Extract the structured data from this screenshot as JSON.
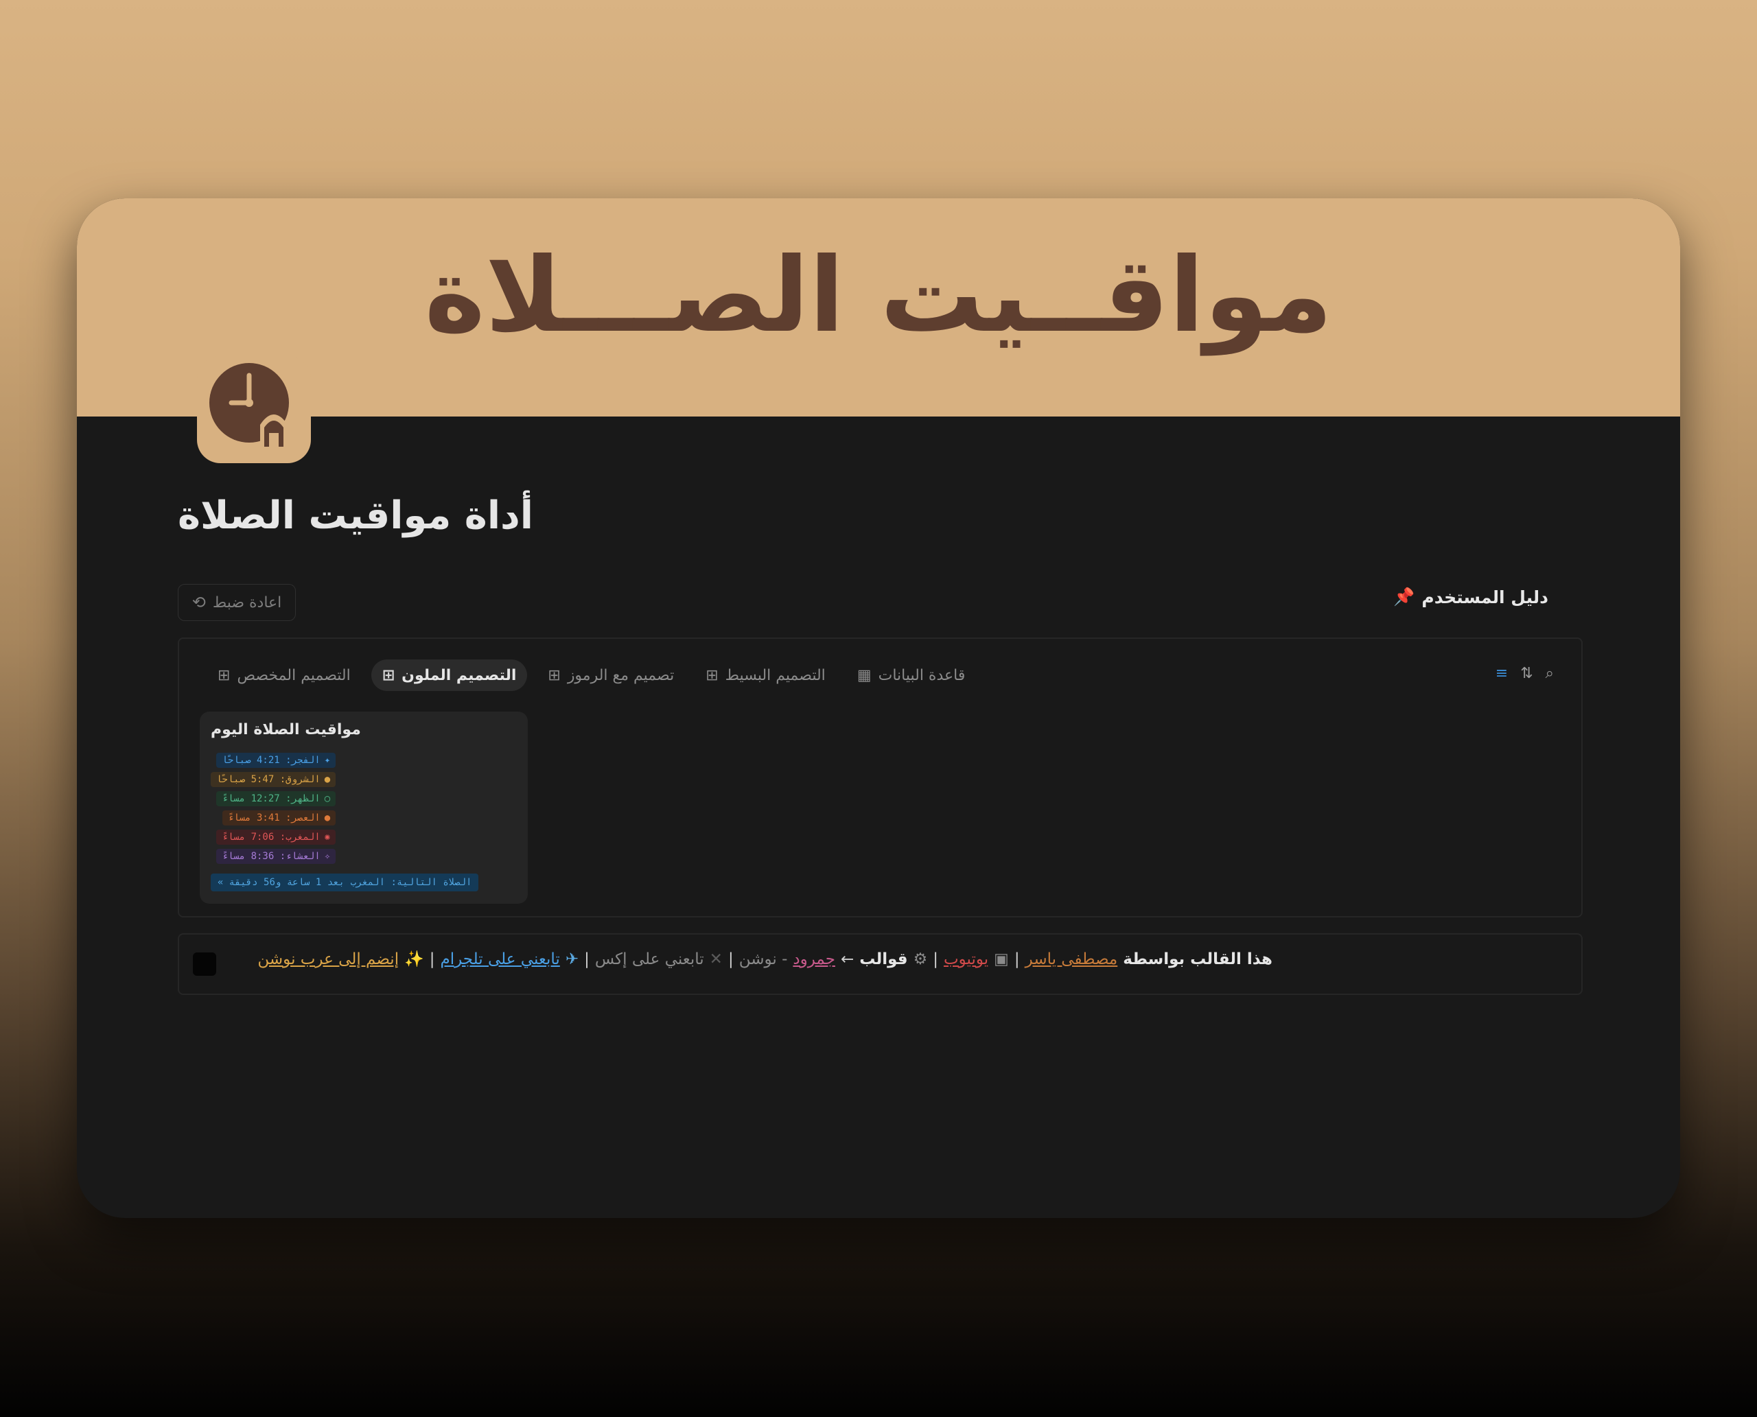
{
  "cover": {
    "title": "مواقــيت الصـــلاة"
  },
  "page": {
    "title": "أداة مواقيت الصلاة",
    "icon": "clock-mosque-icon"
  },
  "toolbar": {
    "reset_label": "اعادة ضبط",
    "guide_label": "دليل المستخدم"
  },
  "database": {
    "tabs": [
      {
        "label": "قاعدة البيانات",
        "icon": "table-icon",
        "active": false
      },
      {
        "label": "التصميم البسيط",
        "icon": "grid-icon",
        "active": false
      },
      {
        "label": "تصميم مع الرموز",
        "icon": "grid-icon",
        "active": false
      },
      {
        "label": "التصميم الملون",
        "icon": "grid-icon",
        "active": true
      },
      {
        "label": "التصميم المخصص",
        "icon": "grid-icon",
        "active": false
      }
    ],
    "tools": [
      "filter-icon",
      "sort-icon",
      "search-icon"
    ],
    "card": {
      "title": "مواقيت الصلاة اليوم",
      "prayers": [
        {
          "text": "الفجر: 4:21 صباحًا",
          "color": "#4aa0e6",
          "bg": "#18324a",
          "marker": "✦"
        },
        {
          "text": "الشروق: 5:47 صباحًا",
          "color": "#d9a347",
          "bg": "#3d3120",
          "marker": "●"
        },
        {
          "text": "الظهر: 12:27 مساءً",
          "color": "#4fb487",
          "bg": "#1f3629",
          "marker": "○"
        },
        {
          "text": "العصر: 3:41 مساءً",
          "color": "#e07a3a",
          "bg": "#3f2a1c",
          "marker": "●"
        },
        {
          "text": "المغرب: 7:06 مساءً",
          "color": "#e05656",
          "bg": "#3f2022",
          "marker": "✺"
        },
        {
          "text": "العشاء: 8:36 مساءً",
          "color": "#a67bd6",
          "bg": "#2e2540",
          "marker": "✧"
        }
      ],
      "next": "الصلاة التالية: المغرب بعد 1 ساعة و56 دقيقة"
    }
  },
  "footer": {
    "by": "هذا القالب بواسطة",
    "author": "مصطفى ياسر",
    "sep": "|",
    "youtube": "يوتيوب",
    "templates": "قوالب",
    "arrow": "←",
    "gumroad": "جمرود",
    "dash": "- نوشن",
    "x_follow": "تابعني على إكس",
    "telegram": "تابعني على تلجرام",
    "join": "إنضم إلى عرب نوشن"
  }
}
